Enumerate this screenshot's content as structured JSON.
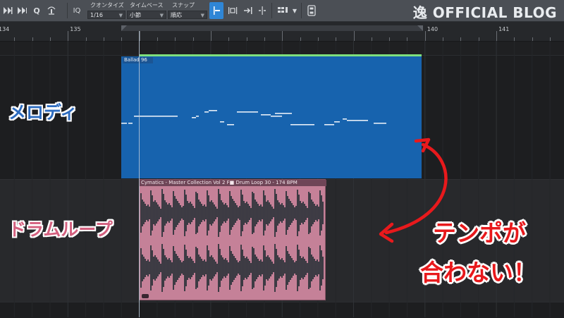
{
  "toolbar": {
    "quantize_header": "クオンタイズ",
    "quantize_value": "1/16",
    "timebase_header": "タイムベース",
    "timebase_value": "小節",
    "snap_header": "スナップ",
    "snap_value": "順応",
    "iq_label": "IQ",
    "q_label": "Q"
  },
  "blog_title": "逸 OFFICIAL BLOG",
  "ruler": {
    "bars": [
      "134",
      "135",
      "136",
      "137",
      "138",
      "139",
      "140",
      "141"
    ]
  },
  "tracks": {
    "melody": {
      "name": "メロディ",
      "clip_name": "Ballad 96",
      "color": "#1763ae"
    },
    "drum": {
      "name": "ドラムループ",
      "clip_name": "Cymatics - Master Collection Vol 2 F■ Drum Loop 30 - 174 BPM",
      "color": "#c58198"
    }
  },
  "annotation": {
    "line1": "テンポが",
    "line2": "合わない！",
    "color": "#e8191c"
  }
}
